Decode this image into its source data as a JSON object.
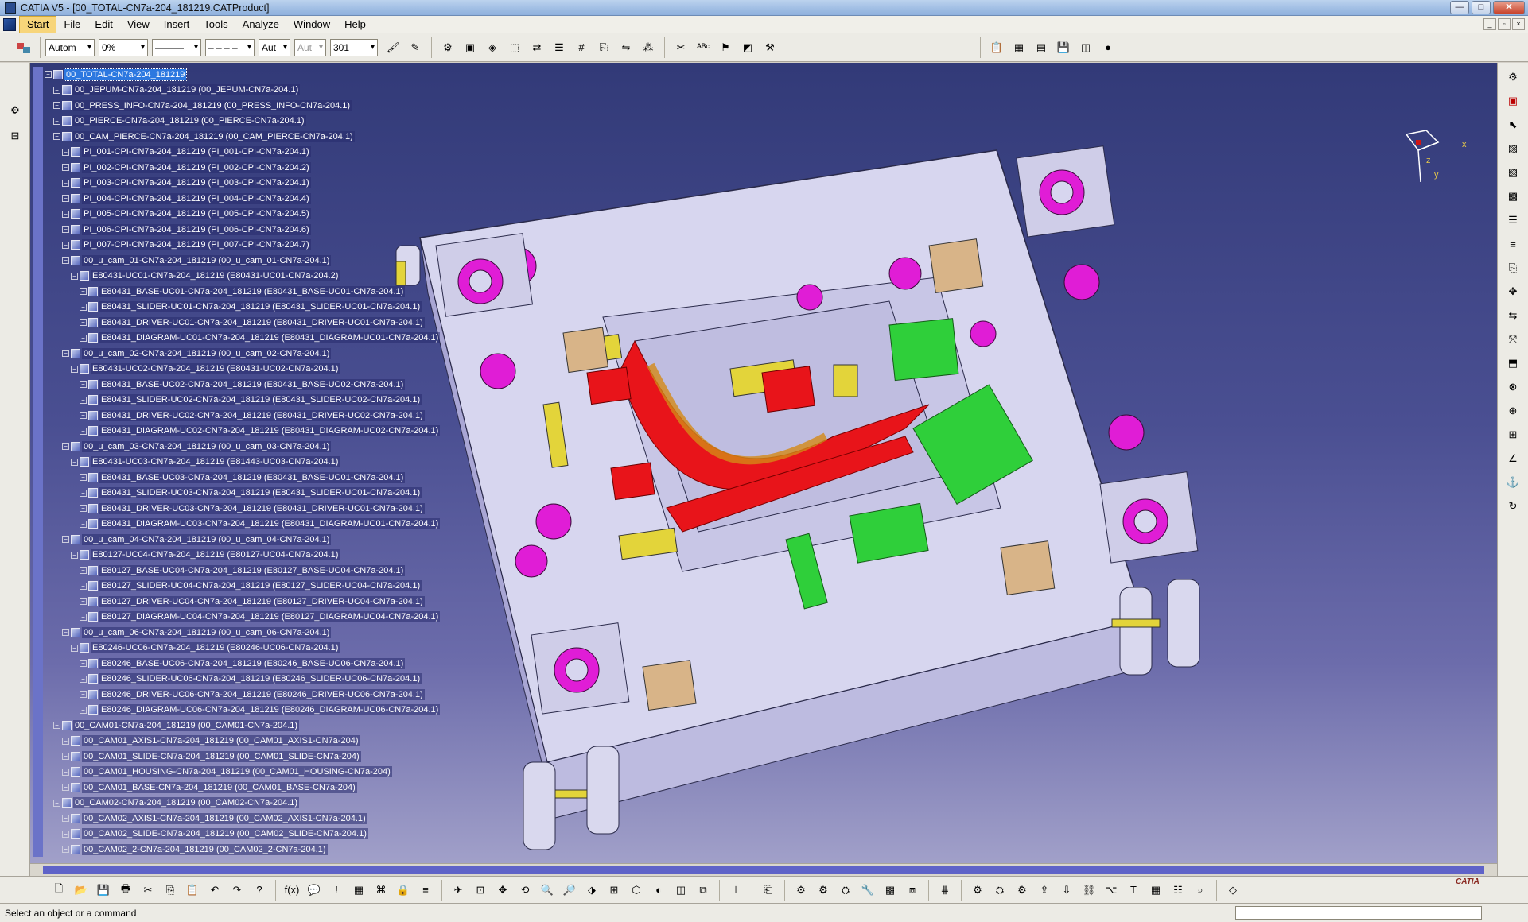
{
  "window": {
    "title": "CATIA V5 - [00_TOTAL-CN7a-204_181219.CATProduct]",
    "buttons": [
      "—",
      "□",
      "✕"
    ]
  },
  "menubar": {
    "items": [
      "Start",
      "File",
      "Edit",
      "View",
      "Insert",
      "Tools",
      "Analyze",
      "Window",
      "Help"
    ],
    "active": "Start"
  },
  "toolbar": {
    "combos": [
      "Autom",
      "0%",
      "———",
      "– – – –",
      "Aut",
      "Aut",
      "301"
    ]
  },
  "tree": {
    "rows": [
      {
        "label": "00_TOTAL-CN7a-204_181219",
        "level": 0,
        "selected": true
      },
      {
        "label": "00_JEPUM-CN7a-204_181219 (00_JEPUM-CN7a-204.1)",
        "level": 1
      },
      {
        "label": "00_PRESS_INFO-CN7a-204_181219 (00_PRESS_INFO-CN7a-204.1)",
        "level": 1
      },
      {
        "label": "00_PIERCE-CN7a-204_181219 (00_PIERCE-CN7a-204.1)",
        "level": 1
      },
      {
        "label": "00_CAM_PIERCE-CN7a-204_181219 (00_CAM_PIERCE-CN7a-204.1)",
        "level": 1
      },
      {
        "label": "PI_001-CPI-CN7a-204_181219 (PI_001-CPI-CN7a-204.1)",
        "level": 2
      },
      {
        "label": "PI_002-CPI-CN7a-204_181219 (PI_002-CPI-CN7a-204.2)",
        "level": 2
      },
      {
        "label": "PI_003-CPI-CN7a-204_181219 (PI_003-CPI-CN7a-204.1)",
        "level": 2
      },
      {
        "label": "PI_004-CPI-CN7a-204_181219 (PI_004-CPI-CN7a-204.4)",
        "level": 2
      },
      {
        "label": "PI_005-CPI-CN7a-204_181219 (PI_005-CPI-CN7a-204.5)",
        "level": 2
      },
      {
        "label": "PI_006-CPI-CN7a-204_181219 (PI_006-CPI-CN7a-204.6)",
        "level": 2
      },
      {
        "label": "PI_007-CPI-CN7a-204_181219 (PI_007-CPI-CN7a-204.7)",
        "level": 2
      },
      {
        "label": "00_u_cam_01-CN7a-204_181219 (00_u_cam_01-CN7a-204.1)",
        "level": 2
      },
      {
        "label": "E80431-UC01-CN7a-204_181219 (E80431-UC01-CN7a-204.2)",
        "level": 3
      },
      {
        "label": "E80431_BASE-UC01-CN7a-204_181219 (E80431_BASE-UC01-CN7a-204.1)",
        "level": 4
      },
      {
        "label": "E80431_SLIDER-UC01-CN7a-204_181219 (E80431_SLIDER-UC01-CN7a-204.1)",
        "level": 4
      },
      {
        "label": "E80431_DRIVER-UC01-CN7a-204_181219 (E80431_DRIVER-UC01-CN7a-204.1)",
        "level": 4
      },
      {
        "label": "E80431_DIAGRAM-UC01-CN7a-204_181219 (E80431_DIAGRAM-UC01-CN7a-204.1)",
        "level": 4
      },
      {
        "label": "00_u_cam_02-CN7a-204_181219 (00_u_cam_02-CN7a-204.1)",
        "level": 2
      },
      {
        "label": "E80431-UC02-CN7a-204_181219 (E80431-UC02-CN7a-204.1)",
        "level": 3
      },
      {
        "label": "E80431_BASE-UC02-CN7a-204_181219 (E80431_BASE-UC02-CN7a-204.1)",
        "level": 4
      },
      {
        "label": "E80431_SLIDER-UC02-CN7a-204_181219 (E80431_SLIDER-UC02-CN7a-204.1)",
        "level": 4
      },
      {
        "label": "E80431_DRIVER-UC02-CN7a-204_181219 (E80431_DRIVER-UC02-CN7a-204.1)",
        "level": 4
      },
      {
        "label": "E80431_DIAGRAM-UC02-CN7a-204_181219 (E80431_DIAGRAM-UC02-CN7a-204.1)",
        "level": 4
      },
      {
        "label": "00_u_cam_03-CN7a-204_181219 (00_u_cam_03-CN7a-204.1)",
        "level": 2
      },
      {
        "label": "E80431-UC03-CN7a-204_181219 (E81443-UC03-CN7a-204.1)",
        "level": 3
      },
      {
        "label": "E80431_BASE-UC03-CN7a-204_181219 (E80431_BASE-UC01-CN7a-204.1)",
        "level": 4
      },
      {
        "label": "E80431_SLIDER-UC03-CN7a-204_181219 (E80431_SLIDER-UC01-CN7a-204.1)",
        "level": 4
      },
      {
        "label": "E80431_DRIVER-UC03-CN7a-204_181219 (E80431_DRIVER-UC01-CN7a-204.1)",
        "level": 4
      },
      {
        "label": "E80431_DIAGRAM-UC03-CN7a-204_181219 (E80431_DIAGRAM-UC01-CN7a-204.1)",
        "level": 4
      },
      {
        "label": "00_u_cam_04-CN7a-204_181219 (00_u_cam_04-CN7a-204.1)",
        "level": 2
      },
      {
        "label": "E80127-UC04-CN7a-204_181219 (E80127-UC04-CN7a-204.1)",
        "level": 3
      },
      {
        "label": "E80127_BASE-UC04-CN7a-204_181219 (E80127_BASE-UC04-CN7a-204.1)",
        "level": 4
      },
      {
        "label": "E80127_SLIDER-UC04-CN7a-204_181219 (E80127_SLIDER-UC04-CN7a-204.1)",
        "level": 4
      },
      {
        "label": "E80127_DRIVER-UC04-CN7a-204_181219 (E80127_DRIVER-UC04-CN7a-204.1)",
        "level": 4
      },
      {
        "label": "E80127_DIAGRAM-UC04-CN7a-204_181219 (E80127_DIAGRAM-UC04-CN7a-204.1)",
        "level": 4
      },
      {
        "label": "00_u_cam_06-CN7a-204_181219 (00_u_cam_06-CN7a-204.1)",
        "level": 2
      },
      {
        "label": "E80246-UC06-CN7a-204_181219 (E80246-UC06-CN7a-204.1)",
        "level": 3
      },
      {
        "label": "E80246_BASE-UC06-CN7a-204_181219 (E80246_BASE-UC06-CN7a-204.1)",
        "level": 4
      },
      {
        "label": "E80246_SLIDER-UC06-CN7a-204_181219 (E80246_SLIDER-UC06-CN7a-204.1)",
        "level": 4
      },
      {
        "label": "E80246_DRIVER-UC06-CN7a-204_181219 (E80246_DRIVER-UC06-CN7a-204.1)",
        "level": 4
      },
      {
        "label": "E80246_DIAGRAM-UC06-CN7a-204_181219 (E80246_DIAGRAM-UC06-CN7a-204.1)",
        "level": 4
      },
      {
        "label": "00_CAM01-CN7a-204_181219 (00_CAM01-CN7a-204.1)",
        "level": 1
      },
      {
        "label": "00_CAM01_AXIS1-CN7a-204_181219 (00_CAM01_AXIS1-CN7a-204)",
        "level": 2
      },
      {
        "label": "00_CAM01_SLIDE-CN7a-204_181219 (00_CAM01_SLIDE-CN7a-204)",
        "level": 2
      },
      {
        "label": "00_CAM01_HOUSING-CN7a-204_181219 (00_CAM01_HOUSING-CN7a-204)",
        "level": 2
      },
      {
        "label": "00_CAM01_BASE-CN7a-204_181219 (00_CAM01_BASE-CN7a-204)",
        "level": 2
      },
      {
        "label": "00_CAM02-CN7a-204_181219 (00_CAM02-CN7a-204.1)",
        "level": 1
      },
      {
        "label": "00_CAM02_AXIS1-CN7a-204_181219 (00_CAM02_AXIS1-CN7a-204.1)",
        "level": 2
      },
      {
        "label": "00_CAM02_SLIDE-CN7a-204_181219 (00_CAM02_SLIDE-CN7a-204.1)",
        "level": 2
      },
      {
        "label": "00_CAM02_2-CN7a-204_181219 (00_CAM02_2-CN7a-204.1)",
        "level": 2
      }
    ]
  },
  "compass": {
    "x_label": "x",
    "y_label": "y",
    "z_label": "z"
  },
  "status": {
    "text": "Select an object or a command"
  },
  "logo": {
    "text": "CATIA"
  },
  "colors": {
    "viewport_top": "#323a78",
    "viewport_bottom": "#a1a0c9",
    "selection": "#2c78e0",
    "accent_active_menu": "#f7d57a"
  }
}
